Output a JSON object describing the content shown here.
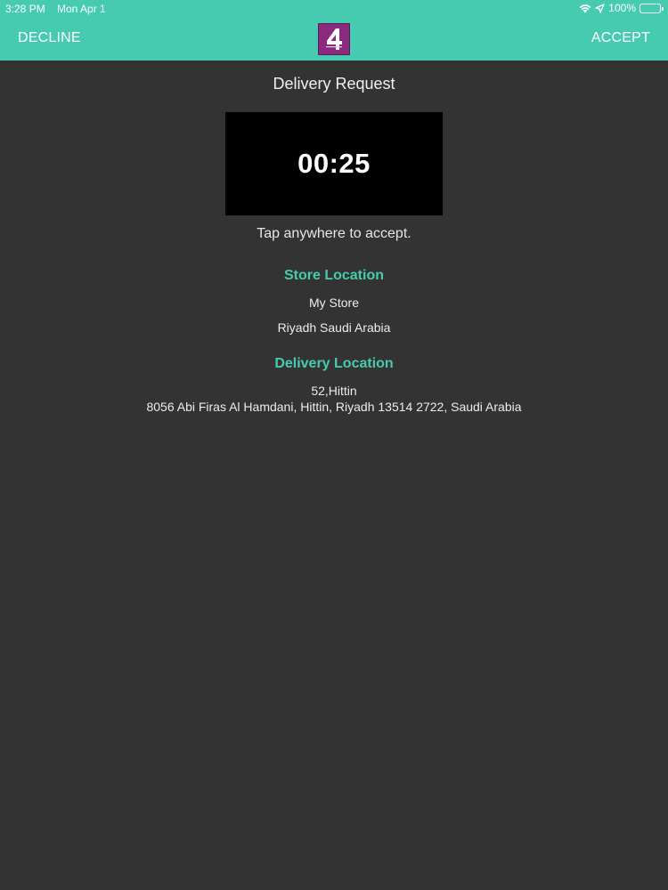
{
  "status_bar": {
    "time": "3:28 PM",
    "date": "Mon Apr 1",
    "battery": "100%"
  },
  "nav": {
    "decline_label": "DECLINE",
    "accept_label": "ACCEPT",
    "logo_text": "4"
  },
  "request": {
    "title": "Delivery Request",
    "timer": "00:25",
    "hint": "Tap anywhere to accept."
  },
  "store_location": {
    "heading": "Store  Location",
    "name": "My Store",
    "city": "Riyadh Saudi Arabia"
  },
  "delivery_location": {
    "heading": "Delivery Location",
    "line1": "52,Hittin",
    "line2": "8056 Abi Firas Al Hamdani,  Hittin,  Riyadh 13514 2722,  Saudi Arabia"
  },
  "colors": {
    "accent": "#47cbb0",
    "background": "#333333",
    "timer_box": "#000000",
    "logo_bg": "#8a2a7e"
  },
  "icons": {
    "wifi": "wifi-icon",
    "location": "location-arrow-icon",
    "battery": "battery-icon",
    "logo": "app-logo-icon"
  }
}
